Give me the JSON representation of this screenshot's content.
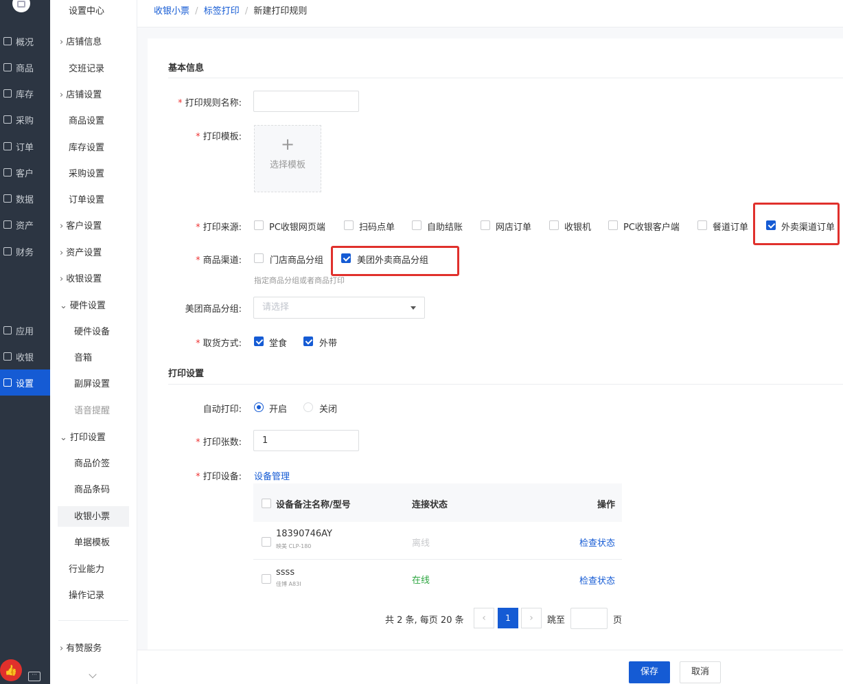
{
  "nav": {
    "items": [
      "概况",
      "商品",
      "库存",
      "采购",
      "订单",
      "客户",
      "数据",
      "资产",
      "财务",
      "应用",
      "收银",
      "设置"
    ],
    "icons": [
      "monitor-icon",
      "tag-icon",
      "warehouse-icon",
      "purchase-icon",
      "order-icon",
      "customer-icon",
      "chart-icon",
      "asset-icon",
      "finance-icon",
      "apps-icon",
      "cashier-icon",
      "gear-icon"
    ],
    "active": "设置",
    "active_color": "#155bd4"
  },
  "subnav": {
    "title": "设置中心",
    "items": [
      {
        "label": "店铺信息",
        "arrow": "›"
      },
      {
        "label": "交班记录",
        "arrow": ""
      },
      {
        "label": "店铺设置",
        "arrow": "›"
      },
      {
        "label": "商品设置",
        "arrow": ""
      },
      {
        "label": "库存设置",
        "arrow": ""
      },
      {
        "label": "采购设置",
        "arrow": ""
      },
      {
        "label": "订单设置",
        "arrow": ""
      },
      {
        "label": "客户设置",
        "arrow": "›"
      },
      {
        "label": "资产设置",
        "arrow": "›"
      },
      {
        "label": "收银设置",
        "arrow": "›"
      },
      {
        "label": "硬件设置",
        "arrow": "⌄"
      },
      {
        "label": "硬件设备",
        "arrow": ""
      },
      {
        "label": "音箱",
        "arrow": ""
      },
      {
        "label": "副屏设置",
        "arrow": ""
      },
      {
        "label": "语音提醒",
        "arrow": ""
      },
      {
        "label": "打印设置",
        "arrow": "⌄"
      },
      {
        "label": "商品价签",
        "arrow": ""
      },
      {
        "label": "商品条码",
        "arrow": ""
      },
      {
        "label": "收银小票",
        "arrow": ""
      },
      {
        "label": "单据模板",
        "arrow": ""
      },
      {
        "label": "行业能力",
        "arrow": ""
      },
      {
        "label": "操作记录",
        "arrow": ""
      }
    ],
    "service": "有赞服务"
  },
  "breadcrumb": {
    "link1": "收银小票",
    "sep": "/",
    "link2": "标签打印",
    "current": "新建打印规则"
  },
  "basic": {
    "section_title": "基本信息",
    "rule_name_label": "打印规则名称:",
    "template_label": "打印模板:",
    "template_plus": "+",
    "template_text": "选择模板",
    "source_label": "打印来源:",
    "sources": [
      "PC收银网页端",
      "扫码点单",
      "自助结账",
      "网店订单",
      "收银机",
      "PC收银客户端",
      "餐道订单",
      "外卖渠道订单"
    ],
    "channel_label": "商品渠道:",
    "channels": [
      "门店商品分组",
      "美团外卖商品分组"
    ],
    "channel_hint": "指定商品分组或者商品打印",
    "mt_group_label": "美团商品分组:",
    "mt_group_placeholder": "请选择",
    "pickup_label": "取货方式:",
    "pickup": [
      "堂食",
      "外带"
    ],
    "required_mark": "*"
  },
  "print": {
    "section_title": "打印设置",
    "auto_label": "自动打印:",
    "auto_on": "开启",
    "auto_off": "关闭",
    "count_label": "打印张数:",
    "count_value": "1",
    "device_label": "打印设备:",
    "device_link": "设备管理",
    "table": {
      "headers": [
        "设备备注名称/型号",
        "连接状态",
        "操作"
      ],
      "rows": [
        {
          "name": "18390746AY",
          "model": "映美 CLP-180",
          "status": "离线",
          "action": "检查状态"
        },
        {
          "name": "ssss",
          "model": "佳博 A83I",
          "status": "在线",
          "action": "检查状态"
        }
      ]
    },
    "pagination": {
      "summary": "共 2 条, 每页 20 条",
      "page": "1",
      "prev": "‹",
      "next": "›",
      "goto": "跳至",
      "page_unit": "页"
    }
  },
  "footer": {
    "save": "保存",
    "cancel": "取消"
  }
}
